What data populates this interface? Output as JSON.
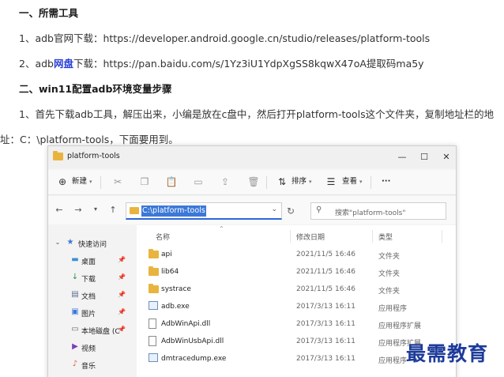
{
  "article": {
    "heading1": "一、所需工具",
    "line1": "1、adb官网下载：https://developer.android.google.cn/studio/releases/platform-tools",
    "line2_prefix": "2、adb",
    "line2_link": "网盘",
    "line2_suffix": "下载：https://pan.baidu.com/s/1Yz3iU1YdpXgSS8kqwX47oA提取码ma5y",
    "heading2": "二、win11配置adb环境变量步骤",
    "para1": "1、首先下载adb工具，解压出来，小编是放在c盘中，然后打开platform-tools这个文件夹，复制地址栏的地",
    "para2": "址：C：\\platform-tools，下面要用到。"
  },
  "explorer": {
    "title": "platform-tools",
    "controls": {
      "minimize": "—",
      "maximize": "☐",
      "close": "✕"
    },
    "toolbar": {
      "new_label": "新建",
      "sort_label": "排序",
      "view_label": "查看",
      "more_label": "···"
    },
    "address": "C:\\platform-tools",
    "search_placeholder": "搜索\"platform-tools\"",
    "sidebar": [
      {
        "label": "快速访问",
        "icon": "star-icon",
        "pinned": false,
        "expanded": true
      },
      {
        "label": "桌面",
        "icon": "desktop-icon",
        "pinned": true
      },
      {
        "label": "下载",
        "icon": "download-icon",
        "pinned": true
      },
      {
        "label": "文档",
        "icon": "document-icon",
        "pinned": true
      },
      {
        "label": "图片",
        "icon": "picture-icon",
        "pinned": true
      },
      {
        "label": "本地磁盘 (C",
        "icon": "drive-icon",
        "pinned": true
      },
      {
        "label": "视频",
        "icon": "video-icon",
        "pinned": false
      },
      {
        "label": "音乐",
        "icon": "music-icon",
        "pinned": false
      }
    ],
    "columns": {
      "name": "名称",
      "modified": "修改日期",
      "type": "类型"
    },
    "files": [
      {
        "name": "api",
        "date": "2021/11/5 16:46",
        "type": "文件夹",
        "icon": "folder-icon"
      },
      {
        "name": "lib64",
        "date": "2021/11/5 16:46",
        "type": "文件夹",
        "icon": "folder-icon"
      },
      {
        "name": "systrace",
        "date": "2021/11/5 16:46",
        "type": "文件夹",
        "icon": "folder-icon"
      },
      {
        "name": "adb.exe",
        "date": "2017/3/13 16:11",
        "type": "应用程序",
        "icon": "exe-icon"
      },
      {
        "name": "AdbWinApi.dll",
        "date": "2017/3/13 16:11",
        "type": "应用程序扩展",
        "icon": "dll-icon"
      },
      {
        "name": "AdbWinUsbApi.dll",
        "date": "2017/3/13 16:11",
        "type": "应用程序扩展",
        "icon": "dll-icon"
      },
      {
        "name": "dmtracedump.exe",
        "date": "2017/3/13 16:11",
        "type": "应用程序",
        "icon": "exe-icon"
      }
    ]
  },
  "watermark": "最需教育",
  "colors": {
    "link": "#2a3fd6",
    "accent": "#3b78d8",
    "folder": "#e9b43e",
    "watermark": "#1d3b9a"
  }
}
